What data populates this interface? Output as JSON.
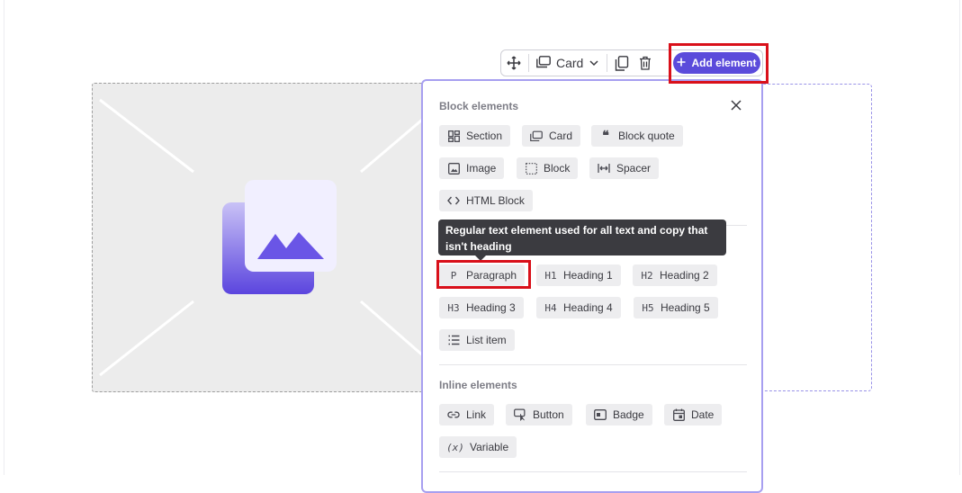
{
  "toolbar": {
    "card_label": "Card",
    "add_element_label": "Add element",
    "icons": [
      "move-icon",
      "card-icon",
      "chevron-down-icon",
      "duplicate-icon",
      "trash-icon",
      "plus-icon"
    ]
  },
  "panel": {
    "block_title": "Block elements",
    "block_items": [
      {
        "label": "Section",
        "icon": "section-icon"
      },
      {
        "label": "Card",
        "icon": "card-icon"
      },
      {
        "label": "Block quote",
        "icon": "quote-icon"
      },
      {
        "label": "Image",
        "icon": "image-icon"
      },
      {
        "label": "Block",
        "icon": "block-icon"
      },
      {
        "label": "Spacer",
        "icon": "spacer-icon"
      },
      {
        "label": "HTML Block",
        "icon": "code-icon"
      }
    ],
    "text_items": [
      {
        "label": "Paragraph",
        "glyph": "P"
      },
      {
        "label": "Heading 1",
        "glyph": "H1"
      },
      {
        "label": "Heading 2",
        "glyph": "H2"
      },
      {
        "label": "Heading 3",
        "glyph": "H3"
      },
      {
        "label": "Heading 4",
        "glyph": "H4"
      },
      {
        "label": "Heading 5",
        "glyph": "H5"
      },
      {
        "label": "List item",
        "icon": "list-icon"
      }
    ],
    "inline_title": "Inline elements",
    "inline_items": [
      {
        "label": "Link",
        "icon": "link-icon"
      },
      {
        "label": "Button",
        "icon": "button-icon"
      },
      {
        "label": "Badge",
        "icon": "badge-icon"
      },
      {
        "label": "Date",
        "icon": "calendar-icon"
      },
      {
        "label": "Variable",
        "glyph": "(x)"
      }
    ]
  },
  "tooltip": {
    "text": "Regular text element used for all text and copy that isn't heading"
  },
  "colors": {
    "accent": "#5b4bdb",
    "highlight": "#d9101a",
    "chip_bg": "#ededef",
    "tooltip_bg": "#3b3b40"
  }
}
